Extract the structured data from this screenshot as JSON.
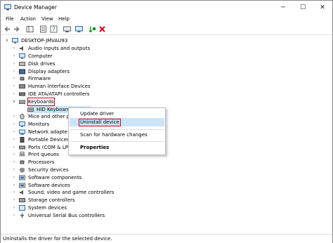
{
  "window": {
    "title": "Device Manager",
    "controls": [
      "─",
      "☐",
      "✕"
    ]
  },
  "menu": [
    "File",
    "Action",
    "View",
    "Help"
  ],
  "toolbar": [
    "back-icon",
    "forward-icon",
    "show-hide-console-tree-icon",
    "properties-icon",
    "help-icon",
    "update-driver-icon",
    "scan-hardware-icon",
    "enable-device-icon",
    "uninstall-device-icon"
  ],
  "tree": {
    "root": "DESKTOP-JMVAU93",
    "categories": [
      {
        "label": "Audio inputs and outputs",
        "icon": "speaker"
      },
      {
        "label": "Computer",
        "icon": "monitor"
      },
      {
        "label": "Disk drives",
        "icon": "disk"
      },
      {
        "label": "Display adapters",
        "icon": "display"
      },
      {
        "label": "Firmware",
        "icon": "chip"
      },
      {
        "label": "Human Interface Devices",
        "icon": "hid"
      },
      {
        "label": "IDE ATA/ATAPI controllers",
        "icon": "ide"
      },
      {
        "label": "Keyboards",
        "icon": "keyboard",
        "expanded": true
      },
      {
        "label": "Mice and other p",
        "icon": "mouse"
      },
      {
        "label": "Monitors",
        "icon": "monitor"
      },
      {
        "label": "Network adapte",
        "icon": "network"
      },
      {
        "label": "Portable Devices",
        "icon": "portable"
      },
      {
        "label": "Ports (COM & LP",
        "icon": "port"
      },
      {
        "label": "Print queues",
        "icon": "printer"
      },
      {
        "label": "Processors",
        "icon": "chip"
      },
      {
        "label": "Security devices",
        "icon": "security"
      },
      {
        "label": "Software components",
        "icon": "software"
      },
      {
        "label": "Software devices",
        "icon": "software"
      },
      {
        "label": "Sound, video and game controllers",
        "icon": "speaker"
      },
      {
        "label": "Storage controllers",
        "icon": "storage"
      },
      {
        "label": "System devices",
        "icon": "system"
      },
      {
        "label": "Universal Serial Bus controllers",
        "icon": "usb"
      }
    ],
    "keyboard_child": "HID Keyboard"
  },
  "context_menu": {
    "update": "Update driver",
    "uninstall": "Uninstall device",
    "scan": "Scan for hardware changes",
    "properties": "Properties"
  },
  "status": "Uninstalls the driver for the selected device.",
  "colors": {
    "highlight": "#d0021b",
    "selection": "#cce4f7",
    "icon_blue": "#2a6fb0"
  }
}
